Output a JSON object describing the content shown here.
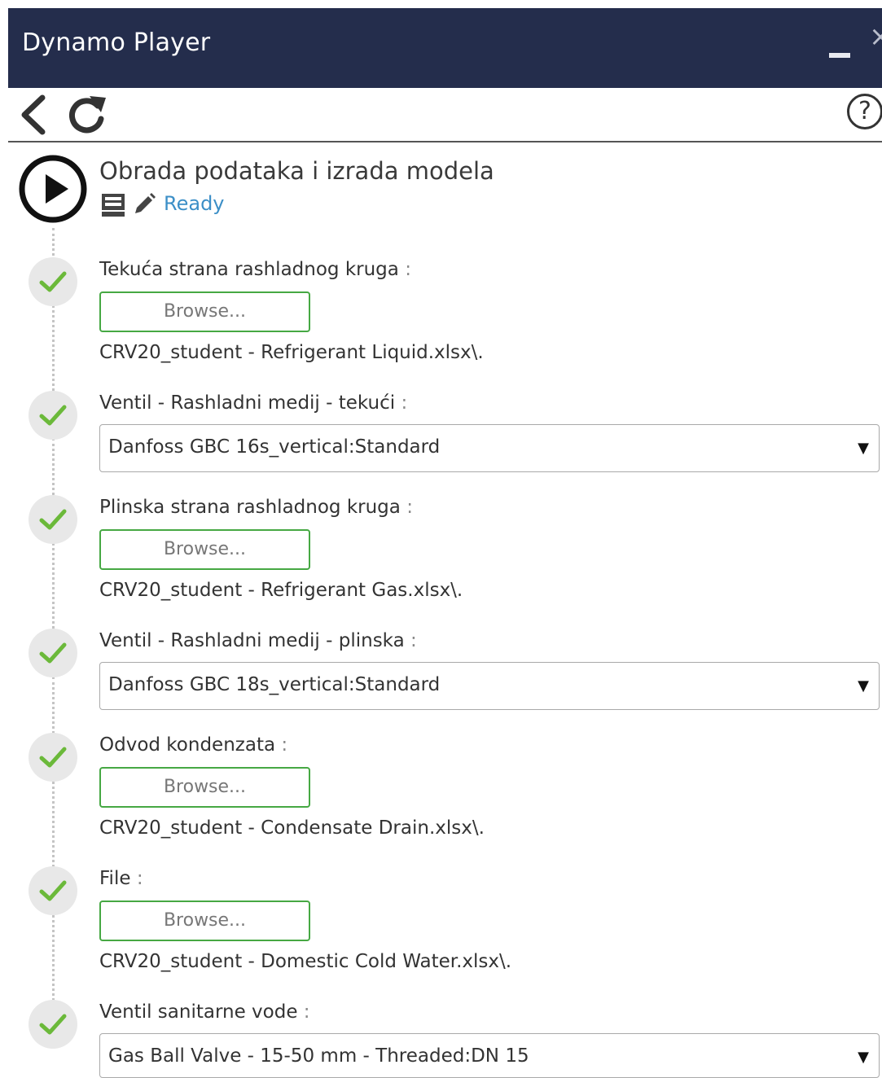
{
  "window": {
    "title": "Dynamo Player",
    "minimize": "–",
    "close": "×"
  },
  "toolbar": {
    "help": "?"
  },
  "graph": {
    "title": "Obrada podataka i izrada modela",
    "status": "Ready"
  },
  "inputs": [
    {
      "label": "Tekuća strana rashladnog kruga",
      "colon": ":",
      "button": "Browse...",
      "value": "CRV20_student - Refrigerant Liquid.xlsx\\."
    },
    {
      "label": "Ventil - Rashladni medij - tekući",
      "colon": ":",
      "value": "Danfoss GBC 16s_vertical:Standard",
      "arrow": "▼"
    },
    {
      "label": "Plinska strana rashladnog kruga",
      "colon": ":",
      "button": "Browse...",
      "value": "CRV20_student - Refrigerant Gas.xlsx\\."
    },
    {
      "label": "Ventil - Rashladni medij - plinska",
      "colon": ":",
      "value": "Danfoss GBC 18s_vertical:Standard",
      "arrow": "▼"
    },
    {
      "label": "Odvod kondenzata",
      "colon": ":",
      "button": "Browse...",
      "value": "CRV20_student - Condensate Drain.xlsx\\."
    },
    {
      "label": "File",
      "colon": ":",
      "button": "Browse...",
      "value": "CRV20_student - Domestic Cold Water.xlsx\\."
    },
    {
      "label": "Ventil sanitarne vode",
      "colon": ":",
      "value": "Gas Ball Valve - 15-50 mm - Threaded:DN 15",
      "arrow": "▼"
    }
  ]
}
